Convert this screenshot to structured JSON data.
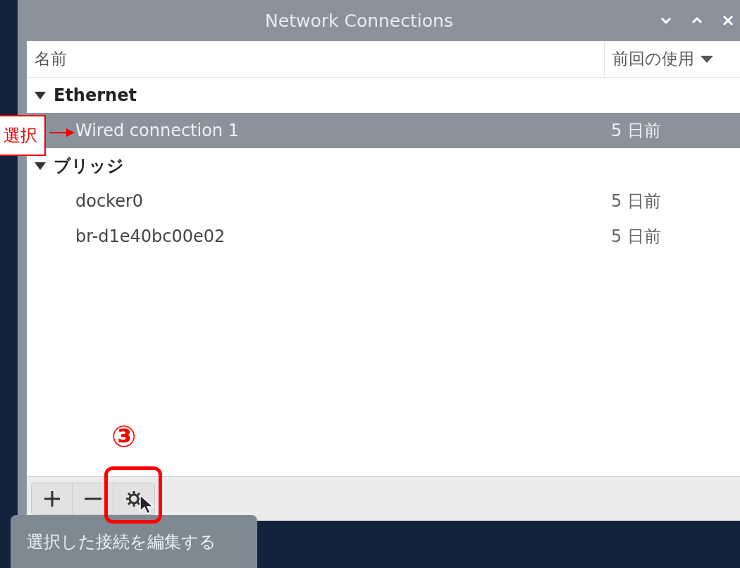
{
  "window": {
    "title": "Network Connections"
  },
  "columns": [
    {
      "label": "名前",
      "sorted": false
    },
    {
      "label": "前回の使用",
      "sorted": true
    }
  ],
  "groups": [
    {
      "name": "Ethernet",
      "expanded": true,
      "connections": [
        {
          "name": "Wired connection 1",
          "last_used": "5 日前",
          "selected": true
        }
      ]
    },
    {
      "name": "ブリッジ",
      "expanded": true,
      "connections": [
        {
          "name": "docker0",
          "last_used": "5 日前",
          "selected": false
        },
        {
          "name": "br-d1e40bc00e02",
          "last_used": "5 日前",
          "selected": false
        }
      ]
    }
  ],
  "toolbar": [
    {
      "kind": "add"
    },
    {
      "kind": "remove"
    },
    {
      "kind": "edit"
    }
  ],
  "tooltip": "選択した接続を編集する",
  "annotations": [
    {
      "kind": "label",
      "text": "選択"
    },
    {
      "kind": "step",
      "text": "③"
    },
    {
      "kind": "highlight"
    }
  ]
}
